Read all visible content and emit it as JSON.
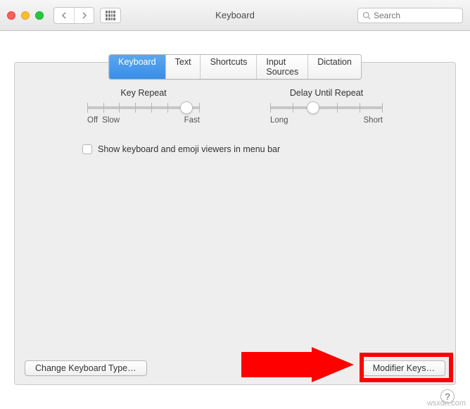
{
  "window": {
    "title": "Keyboard"
  },
  "toolbar": {
    "search_placeholder": "Search"
  },
  "tabs": {
    "items": [
      {
        "label": "Keyboard",
        "active": true
      },
      {
        "label": "Text",
        "active": false
      },
      {
        "label": "Shortcuts",
        "active": false
      },
      {
        "label": "Input Sources",
        "active": false
      },
      {
        "label": "Dictation",
        "active": false
      }
    ]
  },
  "sliders": {
    "key_repeat": {
      "label": "Key Repeat",
      "min_label": "Off",
      "mid_label": "Slow",
      "max_label": "Fast",
      "ticks": 8,
      "value_pct": 88
    },
    "delay_until_repeat": {
      "label": "Delay Until Repeat",
      "min_label": "Long",
      "max_label": "Short",
      "ticks": 6,
      "value_pct": 38
    }
  },
  "checkbox": {
    "show_viewers": "Show keyboard and emoji viewers in menu bar",
    "checked": false
  },
  "buttons": {
    "change_type": "Change Keyboard Type…",
    "modifier_keys": "Modifier Keys…"
  },
  "help": {
    "label": "?"
  },
  "watermark": "wsxdn.com"
}
